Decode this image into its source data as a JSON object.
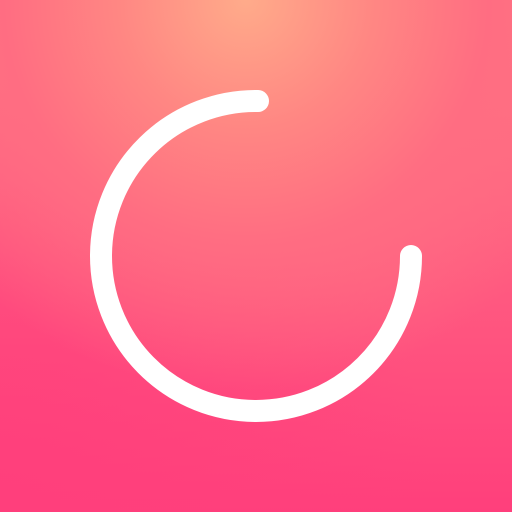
{
  "screen": {
    "colors": {
      "gradient_top": "#ffab8a",
      "gradient_middle": "#ff6d82",
      "gradient_bottom": "#ff3f7c",
      "spinner": "#ffffff"
    },
    "spinner": {
      "icon": "circular-loading-spinner-icon",
      "progress_fraction": 0.76
    }
  }
}
